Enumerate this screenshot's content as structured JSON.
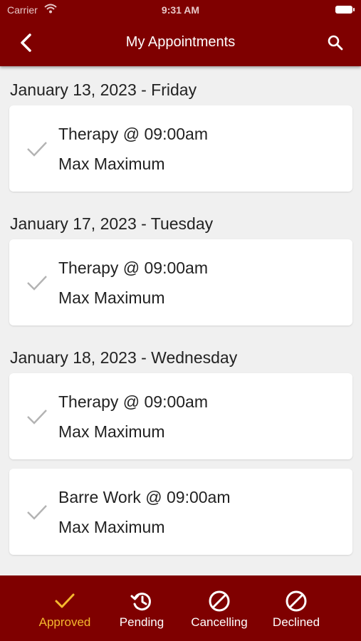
{
  "status_bar": {
    "carrier": "Carrier",
    "time": "9:31 AM"
  },
  "header": {
    "title": "My Appointments"
  },
  "groups": [
    {
      "date": "January 13, 2023 - Friday",
      "appointments": [
        {
          "title": "Therapy @ 09:00am",
          "client": "Max Maximum",
          "status": "approved"
        }
      ]
    },
    {
      "date": "January 17, 2023 - Tuesday",
      "appointments": [
        {
          "title": "Therapy @ 09:00am",
          "client": "Max Maximum",
          "status": "approved"
        }
      ]
    },
    {
      "date": "January 18, 2023 - Wednesday",
      "appointments": [
        {
          "title": "Therapy @ 09:00am",
          "client": "Max Maximum",
          "status": "approved"
        },
        {
          "title": "Barre Work @ 09:00am",
          "client": "Max Maximum",
          "status": "approved"
        }
      ]
    }
  ],
  "tabs": [
    {
      "label": "Approved",
      "icon": "check-icon",
      "active": true
    },
    {
      "label": "Pending",
      "icon": "history-icon",
      "active": false
    },
    {
      "label": "Cancelling",
      "icon": "block-icon",
      "active": false
    },
    {
      "label": "Declined",
      "icon": "block-icon",
      "active": false
    }
  ],
  "colors": {
    "brand": "#7f0000",
    "active_tab": "#f5b82e",
    "background": "#f0f0f0"
  }
}
